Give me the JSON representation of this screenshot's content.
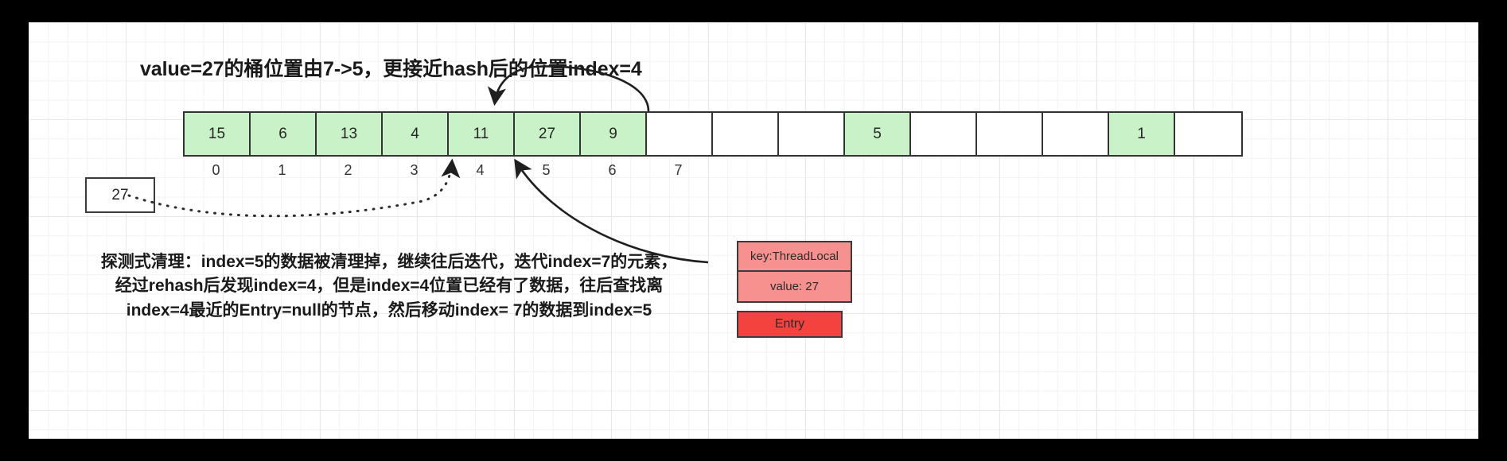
{
  "headline": "value=27的桶位置由7->5，更接近hash后的位置index=4",
  "array": {
    "cells": [
      {
        "value": "15",
        "filled": true
      },
      {
        "value": "6",
        "filled": true
      },
      {
        "value": "13",
        "filled": true
      },
      {
        "value": "4",
        "filled": true
      },
      {
        "value": "11",
        "filled": true
      },
      {
        "value": "27",
        "filled": true
      },
      {
        "value": "9",
        "filled": true
      },
      {
        "value": "",
        "filled": false
      },
      {
        "value": "",
        "filled": false
      },
      {
        "value": "",
        "filled": false
      },
      {
        "value": "5",
        "filled": true
      },
      {
        "value": "",
        "filled": false
      },
      {
        "value": "",
        "filled": false
      },
      {
        "value": "",
        "filled": false
      },
      {
        "value": "1",
        "filled": true
      },
      {
        "value": "",
        "filled": false
      }
    ],
    "indices": [
      "0",
      "1",
      "2",
      "3",
      "4",
      "5",
      "6",
      "7"
    ]
  },
  "value_box": {
    "value": "27"
  },
  "entry_card": {
    "key": "key:ThreadLocal",
    "value": "value: 27",
    "label": "Entry"
  },
  "explanation": {
    "line1": "探测式清理：index=5的数据被清理掉，继续往后迭代，迭代index=7的元素，",
    "line2": "经过rehash后发现index=4，但是index=4位置已经有了数据，往后查找离",
    "line3": "index=4最近的Entry=null的节点，然后移动index= 7的数据到index=5"
  },
  "colors": {
    "filled_cell": "#c9f2c9",
    "entry_row": "#f7918f",
    "entry_label": "#f4423f",
    "stroke": "#333333",
    "grid": "#e8e8e8"
  }
}
